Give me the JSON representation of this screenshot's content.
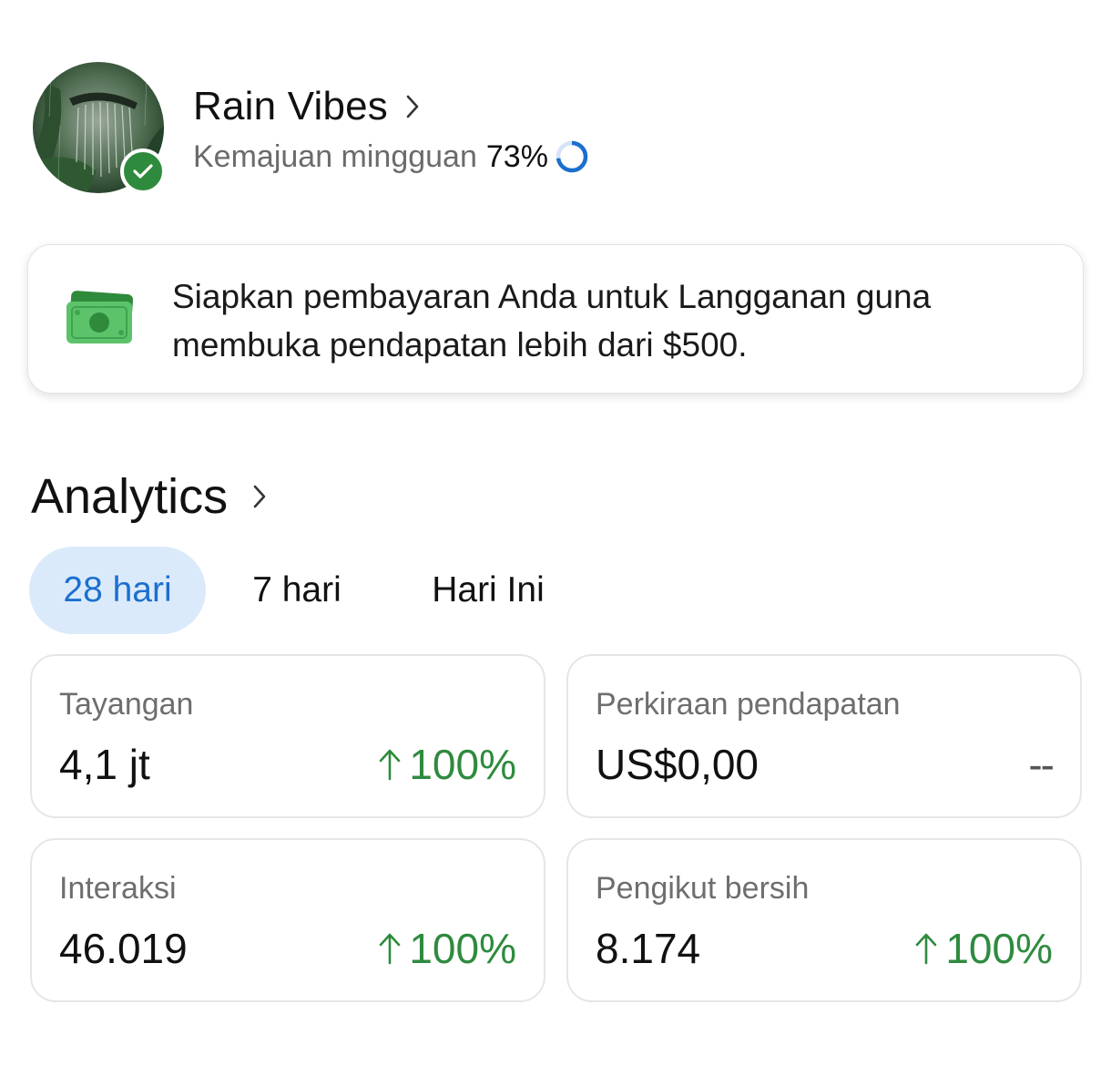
{
  "profile": {
    "name": "Rain Vibes",
    "progress_label": "Kemajuan mingguan",
    "progress_value": "73%",
    "progress_fraction": 0.73
  },
  "banner": {
    "text": "Siapkan pembayaran Anda untuk Langganan guna membuka pendapatan lebih dari $500."
  },
  "analytics": {
    "title": "Analytics",
    "tabs": [
      {
        "label": "28 hari",
        "active": true
      },
      {
        "label": "7 hari",
        "active": false
      },
      {
        "label": "Hari Ini",
        "active": false
      }
    ],
    "cards": [
      {
        "label": "Tayangan",
        "value": "4,1 jt",
        "delta": "100%",
        "trend": "up"
      },
      {
        "label": "Perkiraan pendapatan",
        "value": "US$0,00",
        "delta": "--",
        "trend": "none"
      },
      {
        "label": "Interaksi",
        "value": "46.019",
        "delta": "100%",
        "trend": "up"
      },
      {
        "label": "Pengikut bersih",
        "value": "8.174",
        "delta": "100%",
        "trend": "up"
      }
    ]
  },
  "colors": {
    "accent_blue": "#1b6fcf",
    "tab_active_bg": "#dbeafa",
    "positive_green": "#2e8b3e",
    "verified_green": "#2e8b3e",
    "money_green": "#4caf50"
  },
  "icons": {
    "avatar": "rain-forest-avatar",
    "verified": "check-badge-icon",
    "chevron": "chevron-right-icon",
    "progress": "progress-ring-icon",
    "banner": "money-bill-icon",
    "trend": "arrow-up-icon"
  }
}
